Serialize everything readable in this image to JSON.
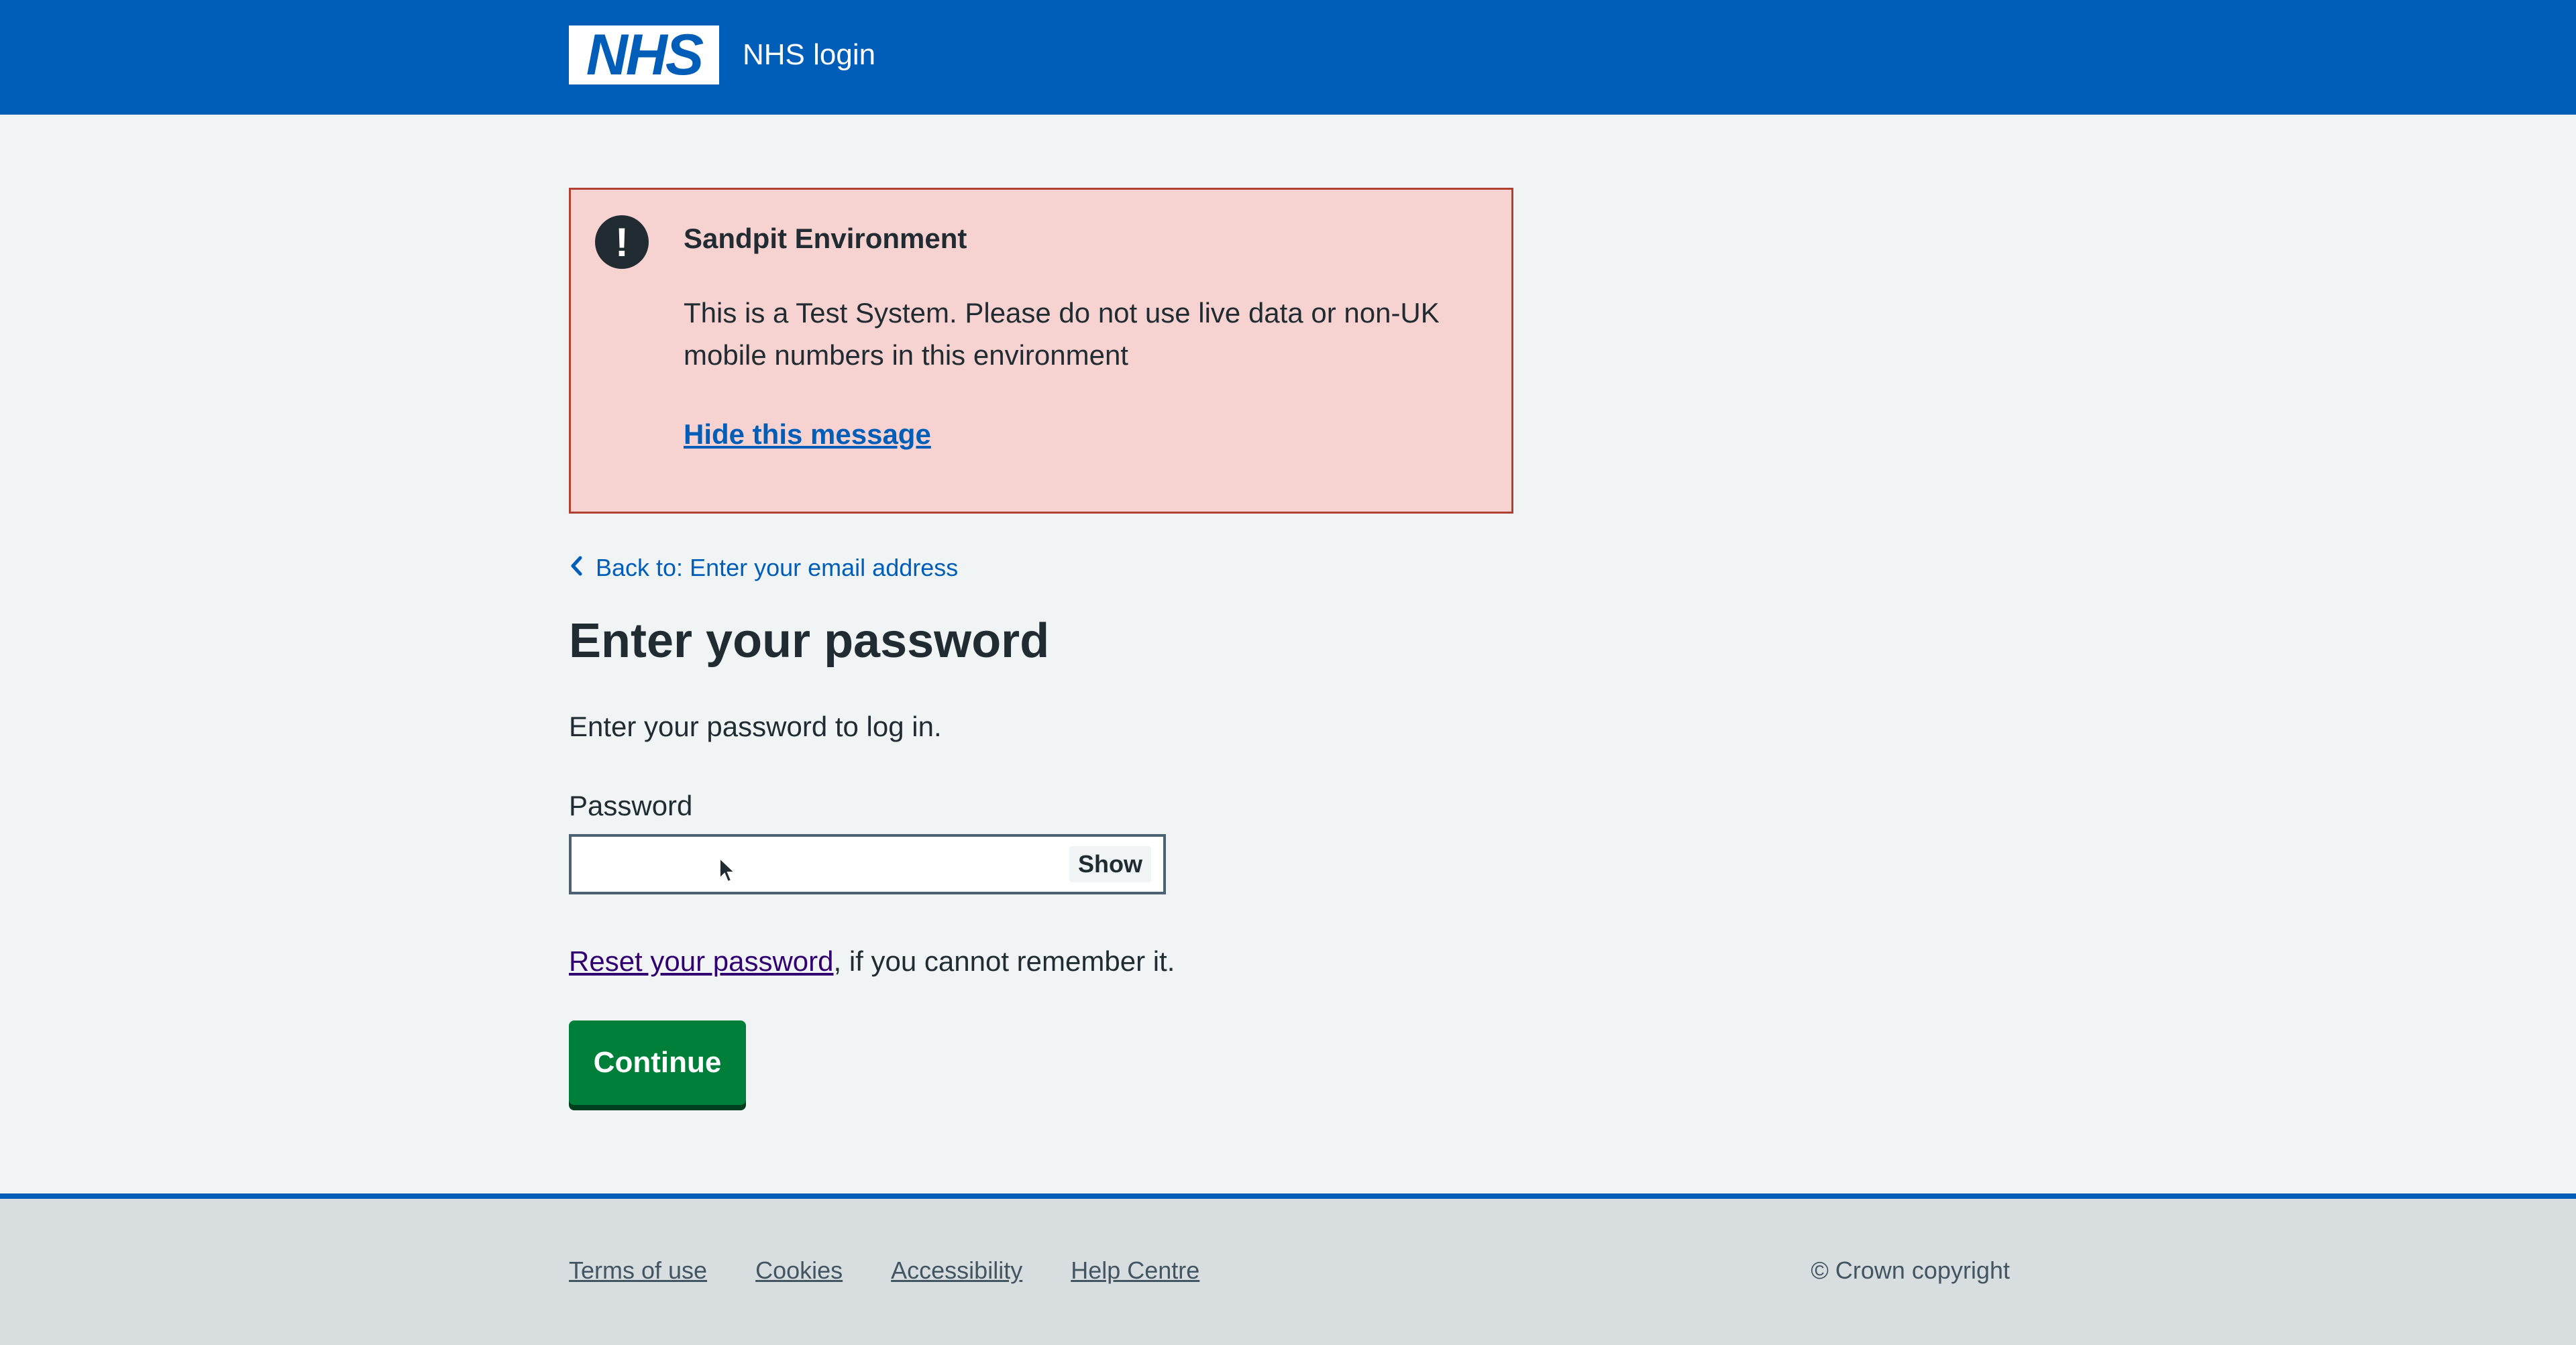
{
  "header": {
    "logo_text": "NHS",
    "service_name": "NHS login"
  },
  "warning": {
    "icon": "exclamation-icon",
    "icon_glyph": "!",
    "title": "Sandpit Environment",
    "body": "This is a Test System. Please do not use live data or non-UK mobile numbers in this environment",
    "hide_link": "Hide this message"
  },
  "back_link": {
    "chevron": "‹",
    "label": "Back to: Enter your email address"
  },
  "main": {
    "title": "Enter your password",
    "intro": "Enter your password to log in.",
    "password_label": "Password",
    "password_value": "",
    "show_button": "Show",
    "reset_link": "Reset your password",
    "reset_suffix": ", if you cannot remember it.",
    "continue_button": "Continue"
  },
  "footer": {
    "links": [
      "Terms of use",
      "Cookies",
      "Accessibility",
      "Help Centre"
    ],
    "copyright": "© Crown copyright"
  },
  "colors": {
    "header_blue": "#005eb8",
    "warning_bg": "#f6d2d1",
    "continue_green": "#007f3b",
    "page_bg": "#f0f4f5",
    "footer_bg": "#d8dde0"
  }
}
